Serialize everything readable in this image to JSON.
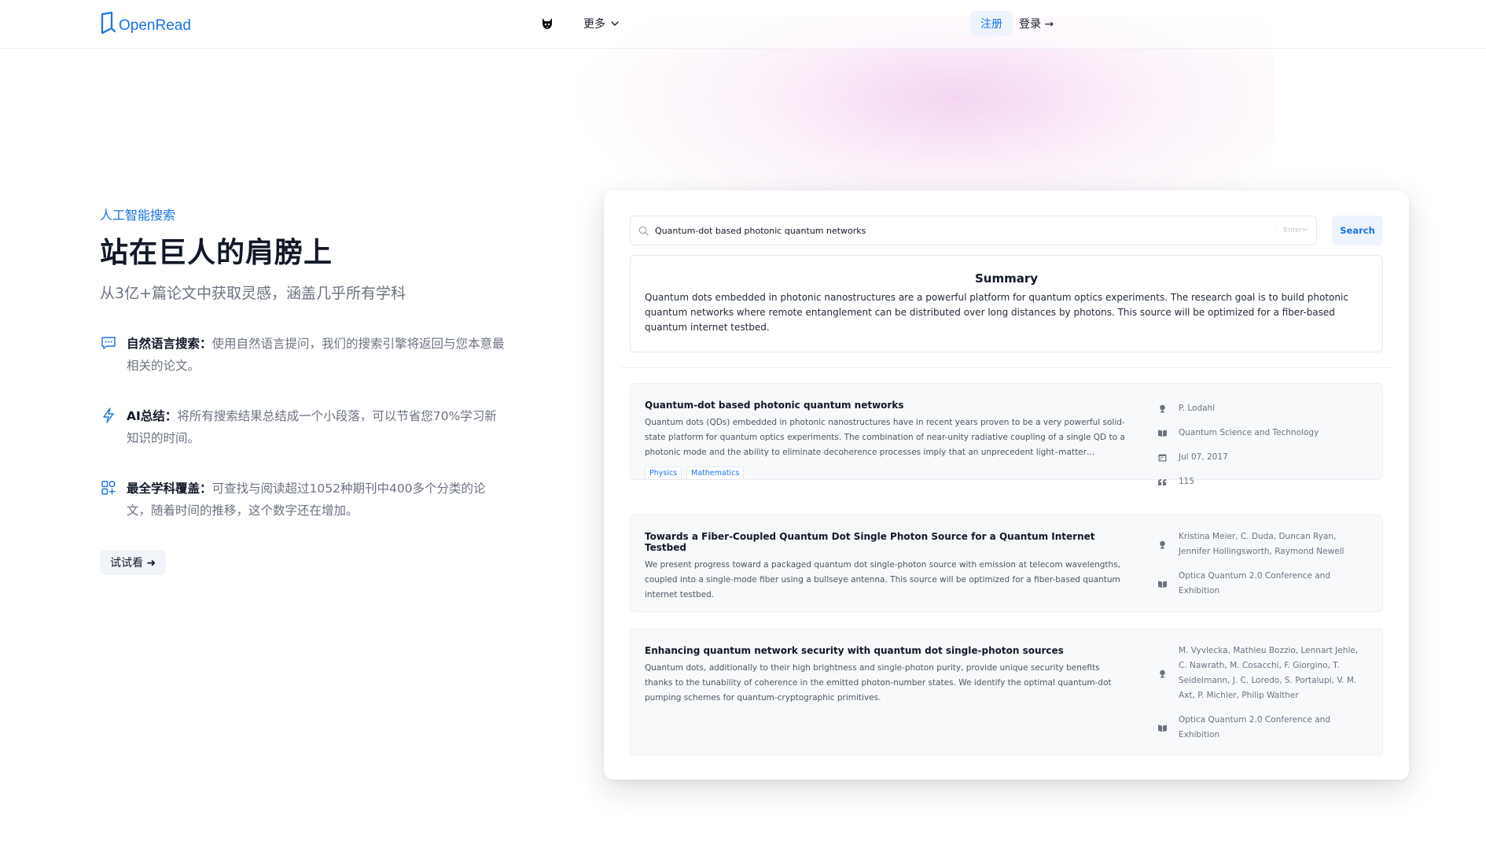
{
  "colors": {
    "accent": "#1a73e8",
    "text": "#111827",
    "muted": "#6b7280"
  },
  "header": {
    "logo_text": "OpenRead",
    "more_label": "更多",
    "register_label": "注册",
    "login_label": "登录 →"
  },
  "hero": {
    "kicker": "人工智能搜索",
    "title": "站在巨人的肩膀上",
    "subtitle": "从3亿+篇论文中获取灵感，涵盖几乎所有学科",
    "features": [
      {
        "icon": "chat-bubble-icon",
        "title": "自然语言搜索：",
        "text": "使用自然语言提问，我们的搜索引擎将返回与您本意最相关的论文。"
      },
      {
        "icon": "lightning-icon",
        "title": "AI总结：",
        "text": "将所有搜索结果总结成一个小段落，可以节省您70%学习新知识的时间。"
      },
      {
        "icon": "grid-icon",
        "title": "最全学科覆盖：",
        "text": "可查找与阅读超过1052种期刊中400多个分类的论文，随着时间的推移，这个数字还在增加。"
      }
    ],
    "try_label": "试试看 ➜"
  },
  "demo": {
    "query": "Quantum-dot based photonic quantum networks",
    "enter_hint": "Enter↵",
    "search_label": "Search",
    "summary_title": "Summary",
    "summary_text": "Quantum dots embedded in photonic nanostructures are a powerful platform for quantum optics experiments. The research goal is to build photonic quantum networks where remote entanglement can be distributed over long distances by photons. This source will be optimized for a fiber-based quantum internet testbed.",
    "results": [
      {
        "title": "Quantum-dot based photonic quantum networks",
        "abstract": "Quantum dots (QDs) embedded in photonic nanostructures have in recent years proven to be a very powerful solid-state platform for quantum optics experiments. The combination of near-unity radiative coupling of a single QD to a photonic mode and the ability to eliminate decoherence processes imply that an unprecedent light–matter interface…",
        "tags": [
          "Physics",
          "Mathematics"
        ],
        "authors": "P. Lodahl",
        "venue": "Quantum Science and Technology",
        "date": "Jul 07, 2017",
        "citations": "115"
      },
      {
        "title": "Towards a Fiber-Coupled Quantum Dot Single Photon Source for a Quantum Internet Testbed",
        "abstract": "We present progress toward a packaged quantum dot single-photon source with emission at telecom wavelengths, coupled into a single-mode fiber using a bullseye antenna. This source will be optimized for a fiber-based quantum internet testbed.",
        "authors": "Kristina Meier, C. Duda, Duncan Ryan, Jennifer Hollingsworth, Raymond Newell",
        "venue": "Optica Quantum 2.0 Conference and Exhibition"
      },
      {
        "title": "Enhancing quantum network security with quantum dot single-photon sources",
        "abstract": "Quantum dots, additionally to their high brightness and single-photon purity, provide unique security benefits thanks to the tunability of coherence in the emitted photon-number states. We identify the optimal quantum-dot pumping schemes for quantum-cryptographic primitives.",
        "authors": "M. Vyvlecka, Mathieu Bozzio, Lennart Jehle, C. Nawrath, M. Cosacchi, F. Giorgino, T. Seidelmann, J. C. Loredo, S. Portalupi, V. M. Axt, P. Michler, Philip Walther",
        "venue": "Optica Quantum 2.0 Conference and Exhibition"
      }
    ]
  }
}
